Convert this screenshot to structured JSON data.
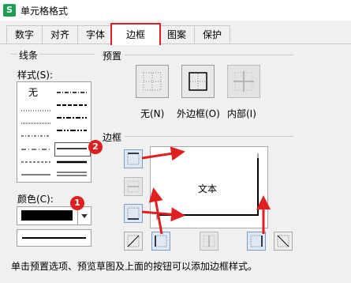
{
  "window": {
    "title": "单元格格式",
    "app_icon": "S"
  },
  "tabs": [
    {
      "label": "数字",
      "active": false
    },
    {
      "label": "对齐",
      "active": false
    },
    {
      "label": "字体",
      "active": false
    },
    {
      "label": "边框",
      "active": true
    },
    {
      "label": "图案",
      "active": false
    },
    {
      "label": "保护",
      "active": false
    }
  ],
  "line": {
    "group_label": "线条",
    "style_label": "样式(S):",
    "none_label": "无",
    "color_label": "颜色(C):",
    "selected_color": "#000000"
  },
  "preset": {
    "group_label": "预置",
    "buttons": [
      {
        "label": "无(N)"
      },
      {
        "label": "外边框(O)"
      },
      {
        "label": "内部(I)"
      }
    ]
  },
  "border": {
    "group_label": "边框",
    "preview_text": "文本"
  },
  "hint": "单击预置选项、预览草图及上面的按钮可以添加边框样式。",
  "callouts": [
    "1",
    "2"
  ],
  "colors": {
    "callout": "#e02020",
    "arrow": "#e02020",
    "active_tab_border": "#e02020"
  }
}
